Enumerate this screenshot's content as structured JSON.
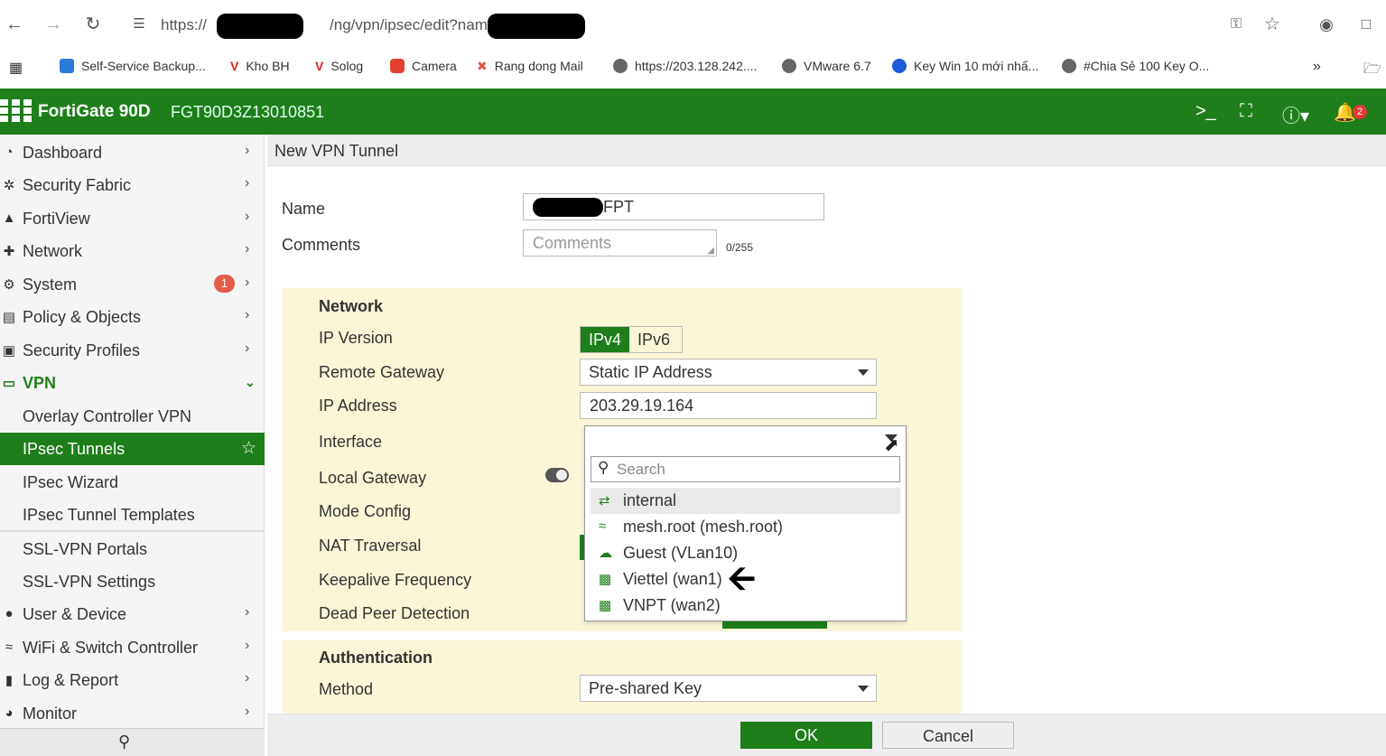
{
  "browser": {
    "url_prefix": "https://",
    "url_middle": "/ng/vpn/ipsec/edit?name=",
    "bookmarks": [
      {
        "label": "Self-Service Backup...",
        "color": "#2b7bd8"
      },
      {
        "label": "Kho BH",
        "color": "#d9231c"
      },
      {
        "label": "Solog",
        "color": "#d9231c"
      },
      {
        "label": "Camera",
        "color": "#e6412f"
      },
      {
        "label": "Rang dong Mail",
        "color": "#e05a47"
      },
      {
        "label": "https://203.128.242....",
        "color": "#555555"
      },
      {
        "label": "VMware 6.7",
        "color": "#555555"
      },
      {
        "label": "Key Win 10 mới nhấ...",
        "color": "#1c5bd8"
      },
      {
        "label": "#Chia Sẻ 100 Key O...",
        "color": "#555555"
      }
    ]
  },
  "header": {
    "brand": "FortiGate 90D",
    "serial": "FGT90D3Z13010851",
    "notification_count": "2",
    "accent": "#1e7f1a"
  },
  "sidebar": {
    "items": [
      {
        "label": "Dashboard",
        "icon": "dashboard-icon"
      },
      {
        "label": "Security Fabric",
        "icon": "fabric-icon"
      },
      {
        "label": "FortiView",
        "icon": "chart-icon"
      },
      {
        "label": "Network",
        "icon": "network-icon"
      },
      {
        "label": "System",
        "icon": "gear-icon",
        "badge": "1"
      },
      {
        "label": "Policy & Objects",
        "icon": "policy-icon"
      },
      {
        "label": "Security Profiles",
        "icon": "lock-icon"
      },
      {
        "label": "VPN",
        "icon": "laptop-icon"
      },
      {
        "label": "Overlay Controller VPN"
      },
      {
        "label": "IPsec Tunnels"
      },
      {
        "label": "IPsec Wizard"
      },
      {
        "label": "IPsec Tunnel Templates"
      },
      {
        "label": "SSL-VPN Portals"
      },
      {
        "label": "SSL-VPN Settings"
      },
      {
        "label": "User & Device",
        "icon": "user-icon"
      },
      {
        "label": "WiFi & Switch Controller",
        "icon": "wifi-icon"
      },
      {
        "label": "Log & Report",
        "icon": "bar-chart-icon"
      },
      {
        "label": "Monitor",
        "icon": "pie-icon"
      }
    ]
  },
  "main": {
    "title": "New VPN Tunnel",
    "name_label": "Name",
    "name_value": "FPT",
    "comments_label": "Comments",
    "comments_placeholder": "Comments",
    "comments_count": "0/255",
    "network": {
      "title": "Network",
      "ip_version_label": "IP Version",
      "ipv4": "IPv4",
      "ipv6": "IPv6",
      "remote_gateway_label": "Remote Gateway",
      "remote_gateway_value": "Static IP Address",
      "ip_address_label": "IP Address",
      "ip_address_value": "203.29.19.164",
      "interface_label": "Interface",
      "local_gateway_label": "Local Gateway",
      "mode_config_label": "Mode Config",
      "nat_traversal_label": "NAT Traversal",
      "keepalive_label": "Keepalive Frequency",
      "dpd_label": "Dead Peer Detection"
    },
    "dropdown": {
      "search_placeholder": "Search",
      "options": [
        {
          "label": "internal",
          "icon": "switch-icon"
        },
        {
          "label": "mesh.root (mesh.root)",
          "icon": "wifi-icon"
        },
        {
          "label": "Guest (VLan10)",
          "icon": "vlan-icon"
        },
        {
          "label": "Viettel (wan1)",
          "icon": "port-icon"
        },
        {
          "label": "VNPT (wan2)",
          "icon": "port-icon"
        }
      ]
    },
    "authentication": {
      "title": "Authentication",
      "method_label": "Method",
      "method_value": "Pre-shared Key"
    }
  },
  "footer": {
    "ok": "OK",
    "cancel": "Cancel"
  }
}
